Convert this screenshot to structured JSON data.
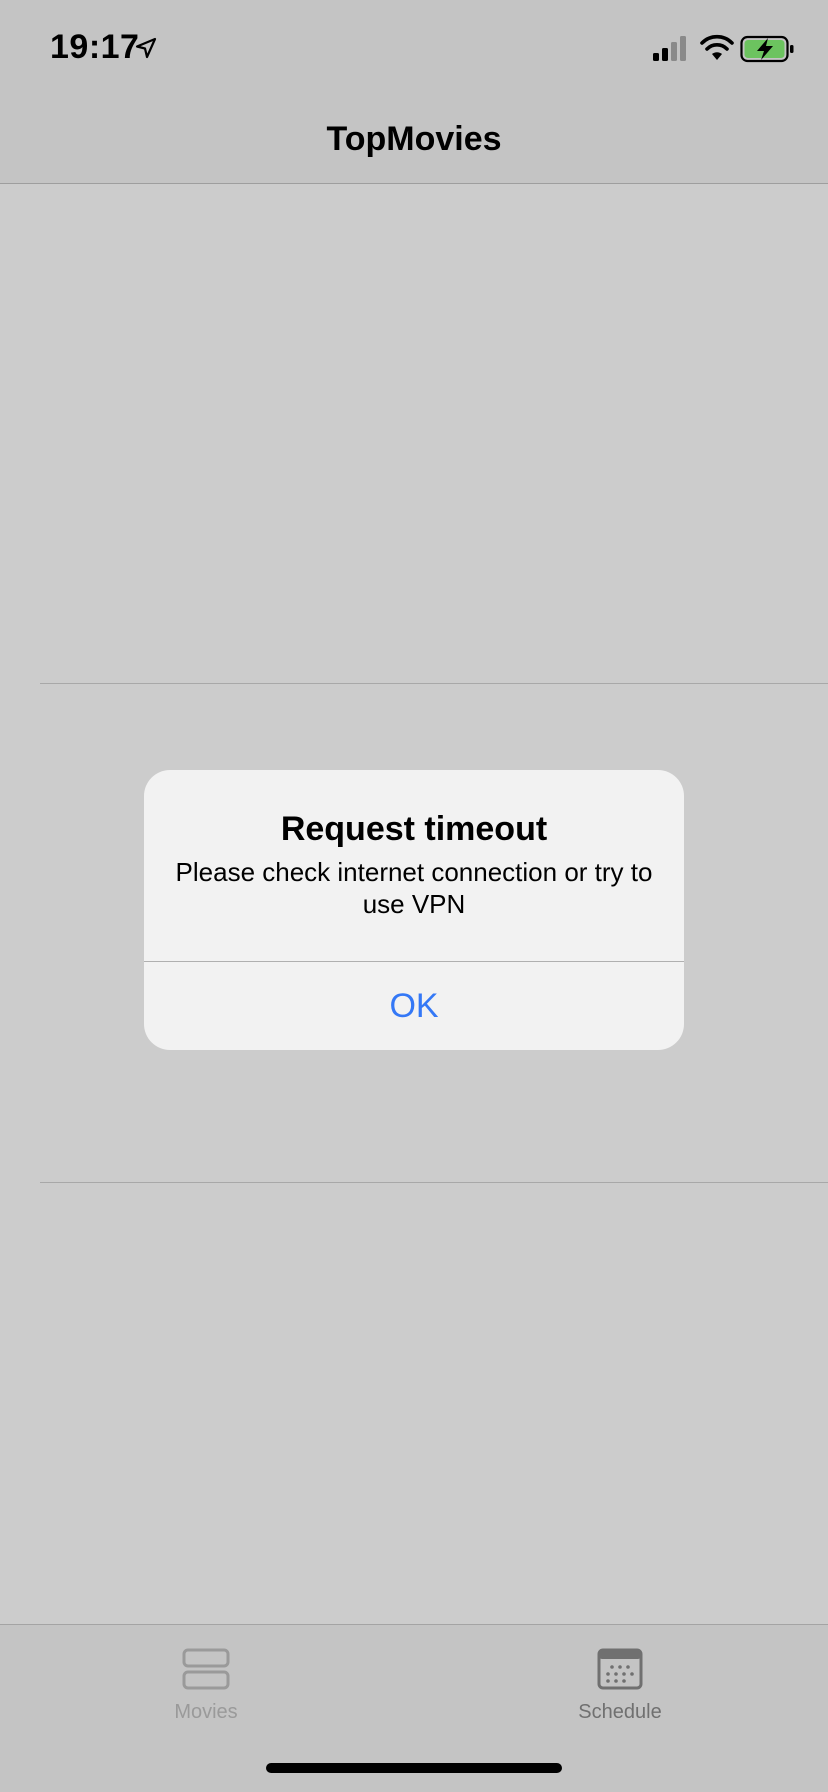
{
  "status_bar": {
    "time": "19:17",
    "icons": [
      "location-arrow-icon",
      "cellular-signal-icon",
      "wifi-icon",
      "battery-charging-icon"
    ]
  },
  "nav": {
    "title": "TopMovies"
  },
  "alert": {
    "title": "Request timeout",
    "message": "Please check internet connection or try to use VPN",
    "ok_label": "OK"
  },
  "tab_bar": {
    "tabs": [
      {
        "label": "Movies",
        "icon": "list-rows-icon"
      },
      {
        "label": "Schedule",
        "icon": "calendar-icon"
      }
    ]
  },
  "colors": {
    "background": "#cccccc",
    "bars": "#c4c4c4",
    "alert_background": "#f2f2f2",
    "accent": "#3478f6",
    "battery_fill": "#6cc35f"
  }
}
